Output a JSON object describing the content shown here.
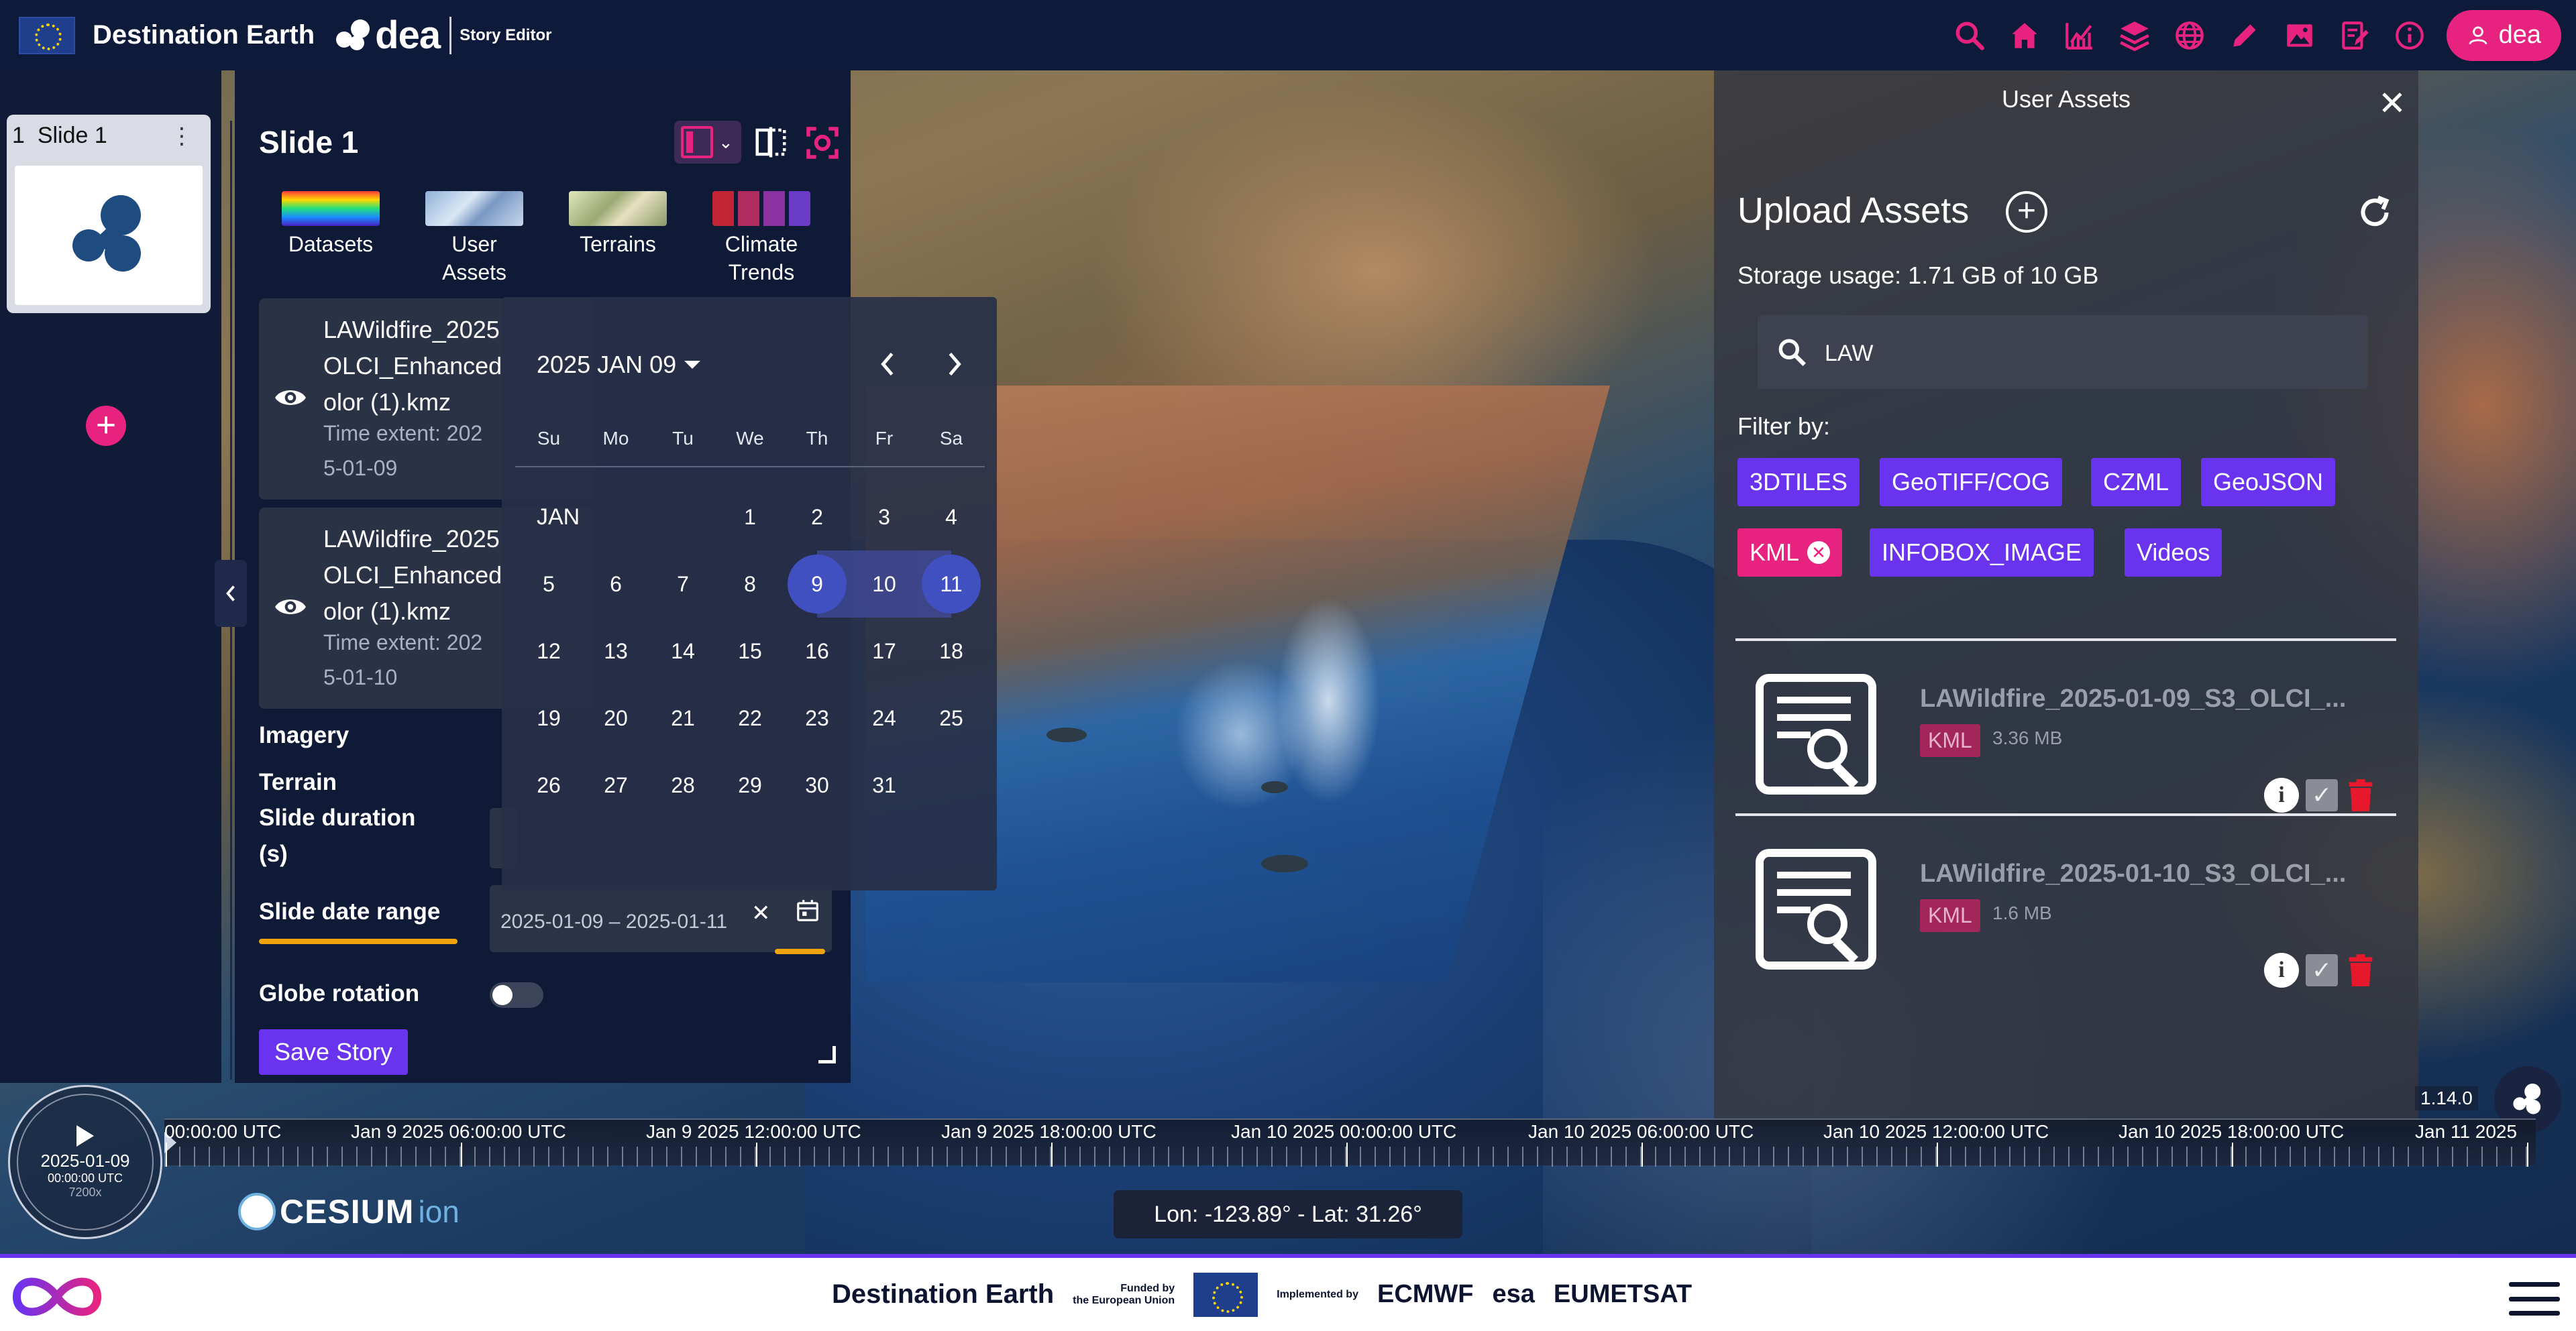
{
  "app": {
    "brand_title": "Destination Earth",
    "dea_word": "dea",
    "subtitle": "Story Editor",
    "user_label": "dea",
    "accent": "#e8237f",
    "primary": "#6a33f0"
  },
  "toolbar": {
    "icons": [
      "search-icon",
      "home-icon",
      "chart-icon",
      "layers-icon",
      "globe-icon",
      "pencil-icon",
      "image-icon",
      "edit-document-icon",
      "info-icon"
    ]
  },
  "slides": {
    "items": [
      {
        "number": "1",
        "label": "Slide 1"
      }
    ]
  },
  "editor": {
    "slide_title": "Slide 1",
    "asset_tabs": [
      {
        "label": "Datasets"
      },
      {
        "label": "User Assets"
      },
      {
        "label": "Terrains"
      },
      {
        "label": "Climate Trends"
      }
    ],
    "layers": [
      {
        "name": "LAWildfire_2025-01-09_S3_OLCI_EnhancedColor (1).kmz",
        "name_lines": [
          "LAWildfire_2025",
          "OLCI_Enhanced",
          "olor (1).kmz"
        ],
        "extent_lines": [
          "Time extent: 202",
          "5-01-09"
        ]
      },
      {
        "name": "LAWildfire_2025-01-10_S3_OLCI_EnhancedColor (1).kmz",
        "name_lines": [
          "LAWildfire_2025",
          "OLCI_Enhanced",
          "olor (1).kmz"
        ],
        "extent_lines": [
          "Time extent: 202",
          "5-01-10"
        ]
      }
    ],
    "imagery_label": "Imagery",
    "terrain_label": "Terrain",
    "slide_duration_label_1": "Slide duration",
    "slide_duration_label_2": "(s)",
    "slide_date_range_label": "Slide date range",
    "slide_date_range_value": "2025-01-09 – 2025-01-11",
    "globe_rotation_label": "Globe rotation",
    "globe_rotation_on": false,
    "save_label": "Save Story"
  },
  "calendar": {
    "header": "2025 JAN 09",
    "weekdays": [
      "Su",
      "Mo",
      "Tu",
      "We",
      "Th",
      "Fr",
      "Sa"
    ],
    "month_label": "JAN",
    "weeks": [
      [
        "",
        "",
        "",
        "1",
        "2",
        "3",
        "4"
      ],
      [
        "5",
        "6",
        "7",
        "8",
        "9",
        "10",
        "11"
      ],
      [
        "12",
        "13",
        "14",
        "15",
        "16",
        "17",
        "18"
      ],
      [
        "19",
        "20",
        "21",
        "22",
        "23",
        "24",
        "25"
      ],
      [
        "26",
        "27",
        "28",
        "29",
        "30",
        "31",
        ""
      ]
    ],
    "range_start": "9",
    "range_end": "11"
  },
  "assets": {
    "title": "User Assets",
    "upload_title": "Upload Assets",
    "storage": "Storage usage: 1.71 GB of 10 GB",
    "search_value": "LAW",
    "filter_label": "Filter by:",
    "filters": [
      "3DTILES",
      "GeoTIFF/COG",
      "CZML",
      "GeoJSON",
      "KML",
      "INFOBOX_IMAGE",
      "Videos"
    ],
    "active_filter": "KML",
    "items": [
      {
        "name": "LAWildfire_2025-01-09_S3_OLCI_...",
        "type": "KML",
        "size": "3.36 MB"
      },
      {
        "name": "LAWildfire_2025-01-10_S3_OLCI_...",
        "type": "KML",
        "size": "1.6 MB"
      }
    ]
  },
  "timeline": {
    "clock_date": "2025-01-09",
    "clock_time": "00:00:00 UTC",
    "clock_speed": "7200x",
    "labels": [
      "00:00:00 UTC",
      "Jan 9 2025 06:00:00 UTC",
      "Jan 9 2025 12:00:00 UTC",
      "Jan 9 2025 18:00:00 UTC",
      "Jan 10 2025 00:00:00 UTC",
      "Jan 10 2025 06:00:00 UTC",
      "Jan 10 2025 12:00:00 UTC",
      "Jan 10 2025 18:00:00 UTC",
      "Jan 11 2025"
    ],
    "version": "1.14.0"
  },
  "map": {
    "coords": "Lon: -123.89° - Lat: 31.26°",
    "cesium_word": "CESIUM",
    "cesium_ion": "ion"
  },
  "footer": {
    "brand": "Destination Earth",
    "funded_line1": "Funded by",
    "funded_line2": "the European Union",
    "implemented_by": "Implemented by",
    "orgs": [
      "ECMWF",
      "esa",
      "EUMETSAT"
    ]
  }
}
